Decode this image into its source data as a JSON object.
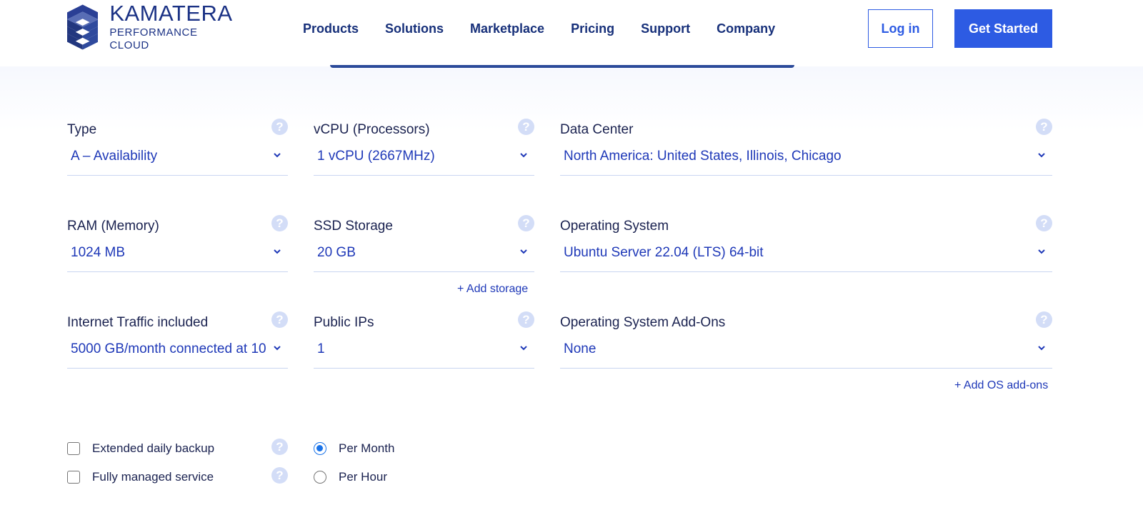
{
  "header": {
    "logo": {
      "name": "KAMATERA",
      "tagline": "PERFORMANCE CLOUD"
    },
    "nav": [
      "Products",
      "Solutions",
      "Marketplace",
      "Pricing",
      "Support",
      "Company"
    ],
    "login_label": "Log in",
    "get_started_label": "Get Started"
  },
  "colors": {
    "brand_navy": "#1b3285",
    "accent_blue": "#2d5be3",
    "value_blue": "#1f39b8",
    "help_icon": "#d3ddf7",
    "radio_checked": "#1a73e8"
  },
  "fields": {
    "type": {
      "label": "Type",
      "value": "A – Availability"
    },
    "vcpu": {
      "label": "vCPU (Processors)",
      "value": "1 vCPU (2667MHz)"
    },
    "datacenter": {
      "label": "Data Center",
      "value": "North America: United States, Illinois, Chicago"
    },
    "ram": {
      "label": "RAM (Memory)",
      "value": "1024 MB"
    },
    "ssd": {
      "label": "SSD Storage",
      "value": "20 GB",
      "add_link": "+ Add storage"
    },
    "os": {
      "label": "Operating System",
      "value": "Ubuntu Server 22.04 (LTS) 64-bit"
    },
    "traffic": {
      "label": "Internet Traffic included",
      "value": "5000 GB/month connected at 10"
    },
    "ips": {
      "label": "Public IPs",
      "value": "1"
    },
    "os_addons": {
      "label": "Operating System Add-Ons",
      "value": "None",
      "add_link": "+ Add OS add-ons"
    }
  },
  "help_icon_glyph": "?",
  "options": {
    "backup": {
      "label": "Extended daily backup",
      "checked": false
    },
    "managed": {
      "label": "Fully managed service",
      "checked": false
    }
  },
  "billing": {
    "per_month": {
      "label": "Per Month",
      "selected": true
    },
    "per_hour": {
      "label": "Per Hour",
      "selected": false
    }
  }
}
